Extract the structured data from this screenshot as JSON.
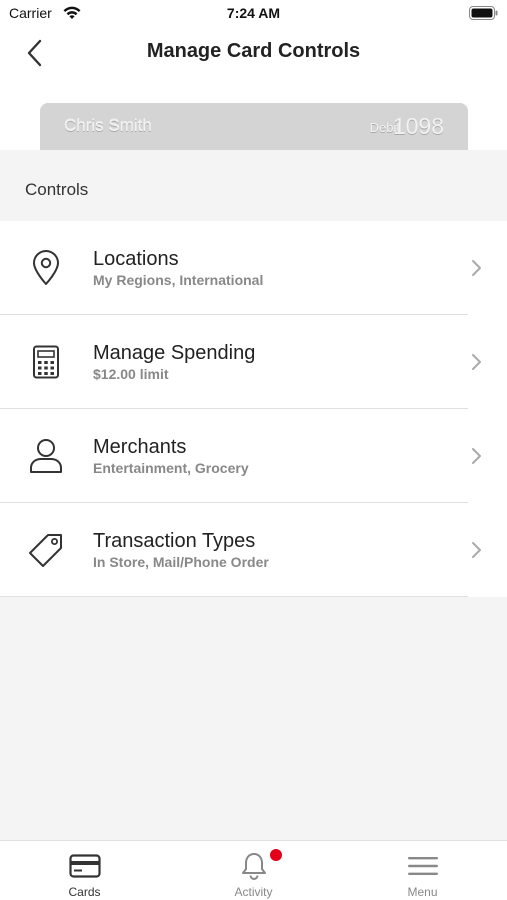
{
  "status_bar": {
    "carrier": "Carrier",
    "time": "7:24 AM",
    "icons": [
      "wifi-icon",
      "battery-icon"
    ]
  },
  "header": {
    "title": "Manage Card Controls",
    "back_icon": "chevron-left-icon"
  },
  "card": {
    "holder_name": "Chris Smith",
    "type": "Debit",
    "last4": "1098",
    "color": "#d4d4d4"
  },
  "controls": {
    "section_title": "Controls",
    "items": [
      {
        "title": "Locations",
        "subtitle": "My Regions, International",
        "icon": "location-pin-icon"
      },
      {
        "title": "Manage Spending",
        "subtitle": "$12.00 limit",
        "icon": "calculator-icon"
      },
      {
        "title": "Merchants",
        "subtitle": "Entertainment, Grocery",
        "icon": "person-icon"
      },
      {
        "title": "Transaction Types",
        "subtitle": "In Store, Mail/Phone Order",
        "icon": "tag-icon"
      }
    ]
  },
  "tab_bar": {
    "tabs": [
      {
        "label": "Cards",
        "icon": "card-icon",
        "active": true
      },
      {
        "label": "Activity",
        "icon": "bell-icon",
        "badge": true
      },
      {
        "label": "Menu",
        "icon": "hamburger-icon"
      }
    ]
  },
  "colors": {
    "badge": "#e4001a",
    "background": "#f4f4f4"
  }
}
